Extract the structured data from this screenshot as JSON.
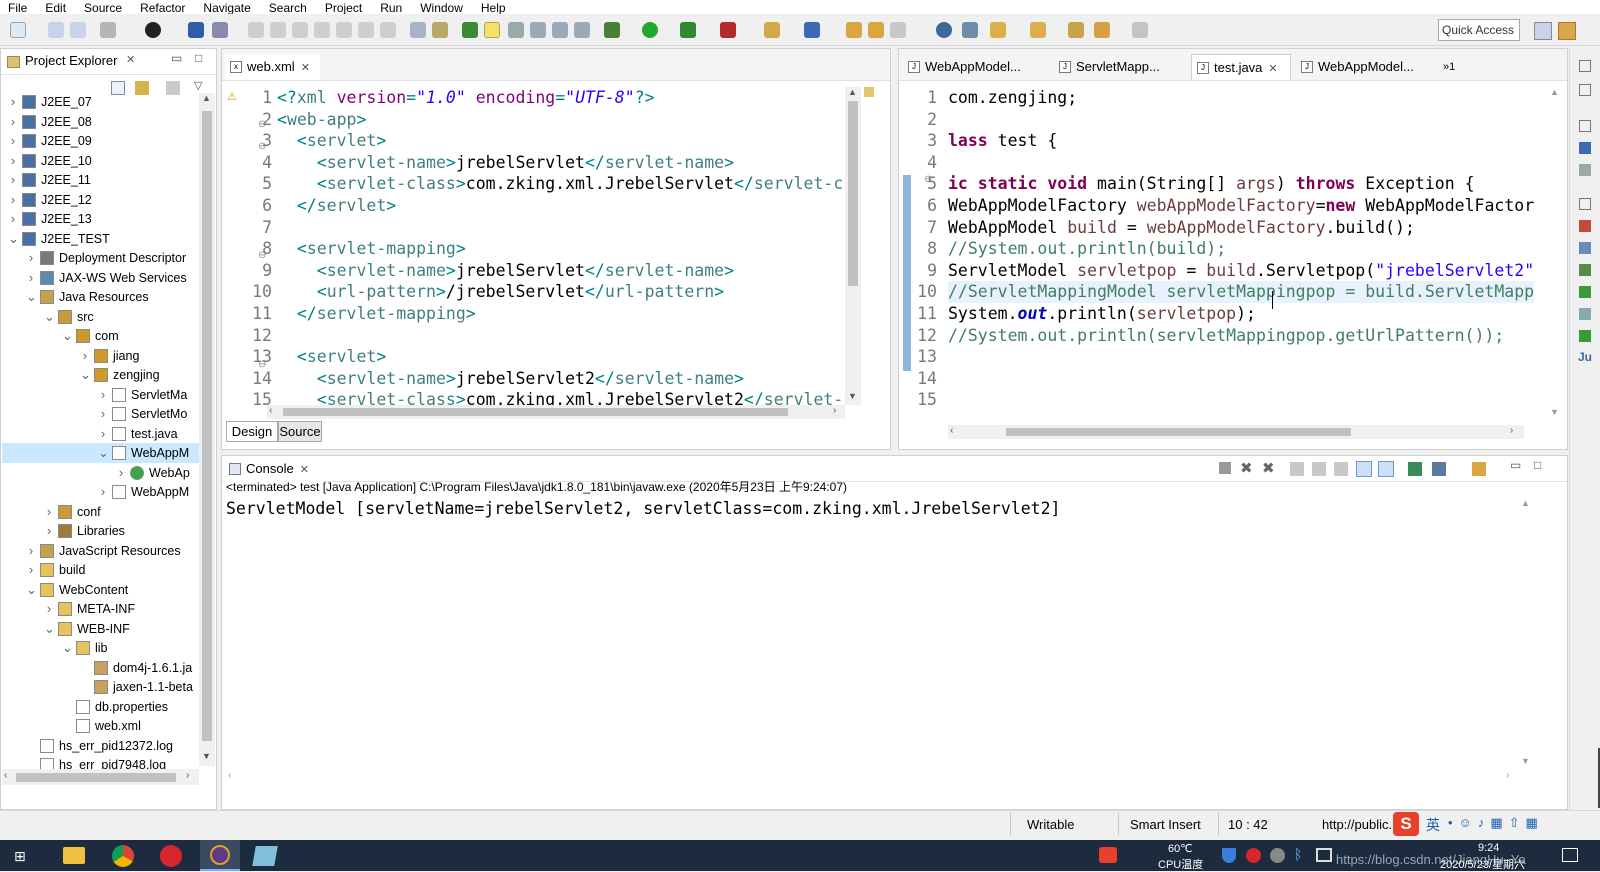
{
  "menu": [
    "File",
    "Edit",
    "Source",
    "Refactor",
    "Navigate",
    "Search",
    "Project",
    "Run",
    "Window",
    "Help"
  ],
  "quick_access": "Quick Access",
  "explorer": {
    "title": "Project Explorer",
    "items": [
      {
        "label": "J2EE_07",
        "depth": 0,
        "toggle": ">",
        "icon": "project-icon"
      },
      {
        "label": "J2EE_08",
        "depth": 0,
        "toggle": ">",
        "icon": "project-icon"
      },
      {
        "label": "J2EE_09",
        "depth": 0,
        "toggle": ">",
        "icon": "project-icon"
      },
      {
        "label": "J2EE_10",
        "depth": 0,
        "toggle": ">",
        "icon": "project-icon"
      },
      {
        "label": "J2EE_11",
        "depth": 0,
        "toggle": ">",
        "icon": "project-icon"
      },
      {
        "label": "J2EE_12",
        "depth": 0,
        "toggle": ">",
        "icon": "project-icon"
      },
      {
        "label": "J2EE_13",
        "depth": 0,
        "toggle": ">",
        "icon": "project-icon"
      },
      {
        "label": "J2EE_TEST",
        "depth": 0,
        "toggle": "v",
        "icon": "project-icon"
      },
      {
        "label": "Deployment Descriptor",
        "depth": 1,
        "toggle": ">",
        "icon": "descriptor-icon"
      },
      {
        "label": "JAX-WS Web Services",
        "depth": 1,
        "toggle": ">",
        "icon": "webservice-icon"
      },
      {
        "label": "Java Resources",
        "depth": 1,
        "toggle": "v",
        "icon": "java-resources-icon"
      },
      {
        "label": "src",
        "depth": 2,
        "toggle": "v",
        "icon": "source-folder-icon"
      },
      {
        "label": "com",
        "depth": 3,
        "toggle": "v",
        "icon": "package-icon"
      },
      {
        "label": "jiang",
        "depth": 4,
        "toggle": ">",
        "icon": "package-icon"
      },
      {
        "label": "zengjing",
        "depth": 4,
        "toggle": "v",
        "icon": "package-icon"
      },
      {
        "label": "ServletMa",
        "depth": 5,
        "toggle": ">",
        "icon": "java-file-icon"
      },
      {
        "label": "ServletMo",
        "depth": 5,
        "toggle": ">",
        "icon": "java-file-icon"
      },
      {
        "label": "test.java",
        "depth": 5,
        "toggle": ">",
        "icon": "java-file-icon"
      },
      {
        "label": "WebAppM",
        "depth": 5,
        "toggle": "v",
        "icon": "java-file-icon",
        "selected": true
      },
      {
        "label": "WebAp",
        "depth": 6,
        "toggle": ">",
        "icon": "class-icon"
      },
      {
        "label": "WebAppM",
        "depth": 5,
        "toggle": ">",
        "icon": "java-file-icon"
      },
      {
        "label": "conf",
        "depth": 2,
        "toggle": ">",
        "icon": "source-folder-icon"
      },
      {
        "label": "Libraries",
        "depth": 2,
        "toggle": ">",
        "icon": "libraries-icon"
      },
      {
        "label": "JavaScript Resources",
        "depth": 1,
        "toggle": ">",
        "icon": "js-resources-icon"
      },
      {
        "label": "build",
        "depth": 1,
        "toggle": ">",
        "icon": "folder-icon"
      },
      {
        "label": "WebContent",
        "depth": 1,
        "toggle": "v",
        "icon": "folder-icon"
      },
      {
        "label": "META-INF",
        "depth": 2,
        "toggle": ">",
        "icon": "folder-icon"
      },
      {
        "label": "WEB-INF",
        "depth": 2,
        "toggle": "v",
        "icon": "folder-icon"
      },
      {
        "label": "lib",
        "depth": 3,
        "toggle": "v",
        "icon": "folder-icon"
      },
      {
        "label": "dom4j-1.6.1.ja",
        "depth": 4,
        "toggle": "",
        "icon": "jar-icon"
      },
      {
        "label": "jaxen-1.1-beta",
        "depth": 4,
        "toggle": "",
        "icon": "jar-icon"
      },
      {
        "label": "db.properties",
        "depth": 3,
        "toggle": "",
        "icon": "file-icon"
      },
      {
        "label": "web.xml",
        "depth": 3,
        "toggle": "",
        "icon": "xml-file-icon"
      },
      {
        "label": "hs_err_pid12372.log",
        "depth": 1,
        "toggle": "",
        "icon": "file-icon"
      },
      {
        "label": "hs_err_pid7948.log",
        "depth": 1,
        "toggle": "",
        "icon": "file-icon"
      }
    ]
  },
  "xml_editor": {
    "tab": "web.xml",
    "bottom_tabs": [
      "Design",
      "Source"
    ],
    "line_numbers": [
      "1",
      "2",
      "3",
      "4",
      "5",
      "6",
      "7",
      "8",
      "9",
      "10",
      "11",
      "12",
      "13",
      "14",
      "15"
    ],
    "lines": [
      [
        [
          "p",
          "<?"
        ],
        [
          "t",
          "xml "
        ],
        [
          "a",
          "version"
        ],
        [
          "p",
          "="
        ],
        [
          "v",
          "\"1.0\""
        ],
        [
          "t",
          " "
        ],
        [
          "a",
          "encoding"
        ],
        [
          "p",
          "="
        ],
        [
          "v",
          "\"UTF-8\""
        ],
        [
          "p",
          "?>"
        ]
      ],
      [
        [
          "p",
          "<"
        ],
        [
          "t",
          "web-app"
        ],
        [
          "p",
          ">"
        ]
      ],
      [
        [
          "n",
          "  "
        ],
        [
          "p",
          "<"
        ],
        [
          "t",
          "servlet"
        ],
        [
          "p",
          ">"
        ]
      ],
      [
        [
          "n",
          "    "
        ],
        [
          "p",
          "<"
        ],
        [
          "t",
          "servlet-name"
        ],
        [
          "p",
          ">"
        ],
        [
          "n",
          "jrebelServlet"
        ],
        [
          "p",
          "</"
        ],
        [
          "t",
          "servlet-name"
        ],
        [
          "p",
          ">"
        ]
      ],
      [
        [
          "n",
          "    "
        ],
        [
          "p",
          "<"
        ],
        [
          "t",
          "servlet-class"
        ],
        [
          "p",
          ">"
        ],
        [
          "n",
          "com.zking.xml.JrebelServlet"
        ],
        [
          "p",
          "</"
        ],
        [
          "t",
          "servlet-cla"
        ]
      ],
      [
        [
          "n",
          "  "
        ],
        [
          "p",
          "</"
        ],
        [
          "t",
          "servlet"
        ],
        [
          "p",
          ">"
        ]
      ],
      [
        [
          "n",
          ""
        ]
      ],
      [
        [
          "n",
          "  "
        ],
        [
          "p",
          "<"
        ],
        [
          "t",
          "servlet-mapping"
        ],
        [
          "p",
          ">"
        ]
      ],
      [
        [
          "n",
          "    "
        ],
        [
          "p",
          "<"
        ],
        [
          "t",
          "servlet-name"
        ],
        [
          "p",
          ">"
        ],
        [
          "n",
          "jrebelServlet"
        ],
        [
          "p",
          "</"
        ],
        [
          "t",
          "servlet-name"
        ],
        [
          "p",
          ">"
        ]
      ],
      [
        [
          "n",
          "    "
        ],
        [
          "p",
          "<"
        ],
        [
          "t",
          "url-pattern"
        ],
        [
          "p",
          ">"
        ],
        [
          "n",
          "/jrebelServlet"
        ],
        [
          "p",
          "</"
        ],
        [
          "t",
          "url-pattern"
        ],
        [
          "p",
          ">"
        ]
      ],
      [
        [
          "n",
          "  "
        ],
        [
          "p",
          "</"
        ],
        [
          "t",
          "servlet-mapping"
        ],
        [
          "p",
          ">"
        ]
      ],
      [
        [
          "n",
          ""
        ]
      ],
      [
        [
          "n",
          "  "
        ],
        [
          "p",
          "<"
        ],
        [
          "t",
          "servlet"
        ],
        [
          "p",
          ">"
        ]
      ],
      [
        [
          "n",
          "    "
        ],
        [
          "p",
          "<"
        ],
        [
          "t",
          "servlet-name"
        ],
        [
          "p",
          ">"
        ],
        [
          "n",
          "jrebelServlet2"
        ],
        [
          "p",
          "</"
        ],
        [
          "t",
          "servlet-name"
        ],
        [
          "p",
          ">"
        ]
      ],
      [
        [
          "n",
          "    "
        ],
        [
          "p",
          "<"
        ],
        [
          "t",
          "servlet-class"
        ],
        [
          "p",
          ">"
        ],
        [
          "n",
          "com.zking.xml.JrebelServlet2"
        ],
        [
          "p",
          "</"
        ],
        [
          "t",
          "servlet-cl"
        ]
      ]
    ]
  },
  "java_editor": {
    "tabs": [
      "WebAppModel...",
      "ServletMapp...",
      "test.java",
      "WebAppModel..."
    ],
    "overflow": "»1",
    "line_numbers": [
      "1",
      "2",
      "3",
      "4",
      "5",
      "6",
      "7",
      "8",
      "9",
      "10",
      "11",
      "12",
      "13",
      "14",
      "15"
    ],
    "lines": [
      [
        [
          "n",
          "com.zengjing;"
        ]
      ],
      [
        [
          "n",
          ""
        ]
      ],
      [
        [
          "k",
          "lass"
        ],
        [
          "n",
          " test {"
        ]
      ],
      [
        [
          "n",
          ""
        ]
      ],
      [
        [
          "k",
          "ic static void"
        ],
        [
          "n",
          " main(String[] "
        ],
        [
          "v",
          "args"
        ],
        [
          "n",
          ") "
        ],
        [
          "k",
          "throws"
        ],
        [
          "n",
          " Exception {"
        ]
      ],
      [
        [
          "n",
          "WebAppModelFactory "
        ],
        [
          "v",
          "webAppModelFactory"
        ],
        [
          "n",
          "="
        ],
        [
          "k",
          "new"
        ],
        [
          "n",
          " WebAppModelFactor"
        ]
      ],
      [
        [
          "n",
          "WebAppModel "
        ],
        [
          "v",
          "build"
        ],
        [
          "n",
          " = "
        ],
        [
          "v",
          "webAppModelFactory"
        ],
        [
          "n",
          ".build();"
        ]
      ],
      [
        [
          "c",
          "//System.out.println(build);"
        ]
      ],
      [
        [
          "n",
          "ServletModel "
        ],
        [
          "v",
          "servletpop"
        ],
        [
          "n",
          " = "
        ],
        [
          "v",
          "build"
        ],
        [
          "n",
          ".Servletpop("
        ],
        [
          "s",
          "\"jrebelServlet2\""
        ]
      ],
      [
        [
          "c",
          "//ServletMappingModel servletMappingpop = build.ServletMapp"
        ]
      ],
      [
        [
          "n",
          "System."
        ],
        [
          "o",
          "out"
        ],
        [
          "n",
          ".println("
        ],
        [
          "v",
          "servletpop"
        ],
        [
          "n",
          ");"
        ]
      ],
      [
        [
          "c",
          "//System.out.println(servletMappingpop.getUrlPattern());"
        ]
      ],
      [
        [
          "n",
          ""
        ]
      ],
      [
        [
          "n",
          ""
        ]
      ],
      [
        [
          "n",
          ""
        ]
      ]
    ]
  },
  "console": {
    "title": "Console",
    "header": "<terminated> test [Java Application] C:\\Program Files\\Java\\jdk1.8.0_181\\bin\\javaw.exe (2020年5月23日 上午9:24:07)",
    "output": "ServletModel [servletName=jrebelServlet2, servletClass=com.zking.xml.JrebelServlet2]"
  },
  "status": {
    "writable": "Writable",
    "insert": "Smart Insert",
    "position": "10 : 42",
    "url": "http://public."
  },
  "taskbar": {
    "cpu_temp": "60℃",
    "cpu_label": "CPU温度",
    "time": "9:24",
    "date": "2020/5/23/星期六",
    "watermark": "https://blog.csdn.net/JiangHu_Ya",
    "ime": "英"
  },
  "colors": {
    "selected_tab_bg": "#ffffff",
    "selected_row": "#cce8ff",
    "comment": "#3f7f5f",
    "keyword": "#7f0055",
    "taskbar": "#1c2b3e"
  }
}
